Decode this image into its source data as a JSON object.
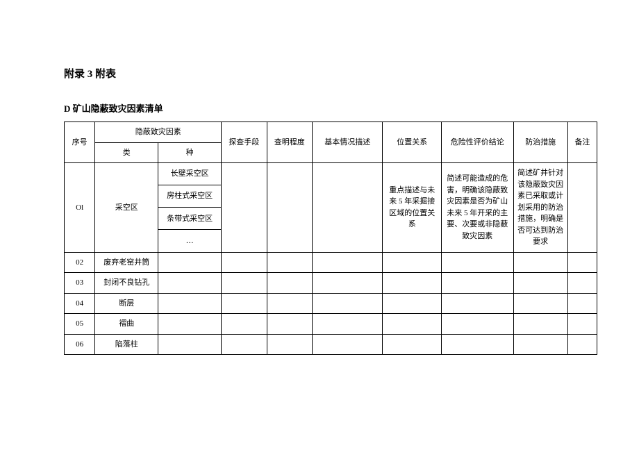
{
  "heading1": "附录 3 附表",
  "heading2": "D 矿山隐蔽致灾因素清单",
  "headers": {
    "seq": "序号",
    "factor_group": "隐蔽致灾因素",
    "category": "类",
    "type": "种",
    "method": "探查手段",
    "degree": "查明程度",
    "desc": "基本情况描述",
    "position": "位置关系",
    "risk": "危险性评价结论",
    "prevention": "防治措施",
    "note": "备注"
  },
  "rows": {
    "r1": {
      "seq": "Ol",
      "category": "采空区",
      "types": [
        "长壁采空区",
        "房柱式采空区",
        "条带式采空区",
        "…"
      ],
      "position": "重点描述与未来 5 年采掘接区域的位置关系",
      "risk": "简述可能造成的危害，明确该隐蔽致灾因素是否为矿山未来 5 年开采的主要、次要或非隐蔽致灾因素",
      "prevention": "简述矿井针对该隐蔽致灾因素已采取或计划采用的防治措施，明确是否可达到防治要求"
    },
    "r2": {
      "seq": "02",
      "category": "废弃老窑井筒"
    },
    "r3": {
      "seq": "03",
      "category": "封闭不良钻孔"
    },
    "r4": {
      "seq": "04",
      "category": "断层"
    },
    "r5": {
      "seq": "05",
      "category": "褶曲"
    },
    "r6": {
      "seq": "06",
      "category": "陷落柱"
    }
  }
}
